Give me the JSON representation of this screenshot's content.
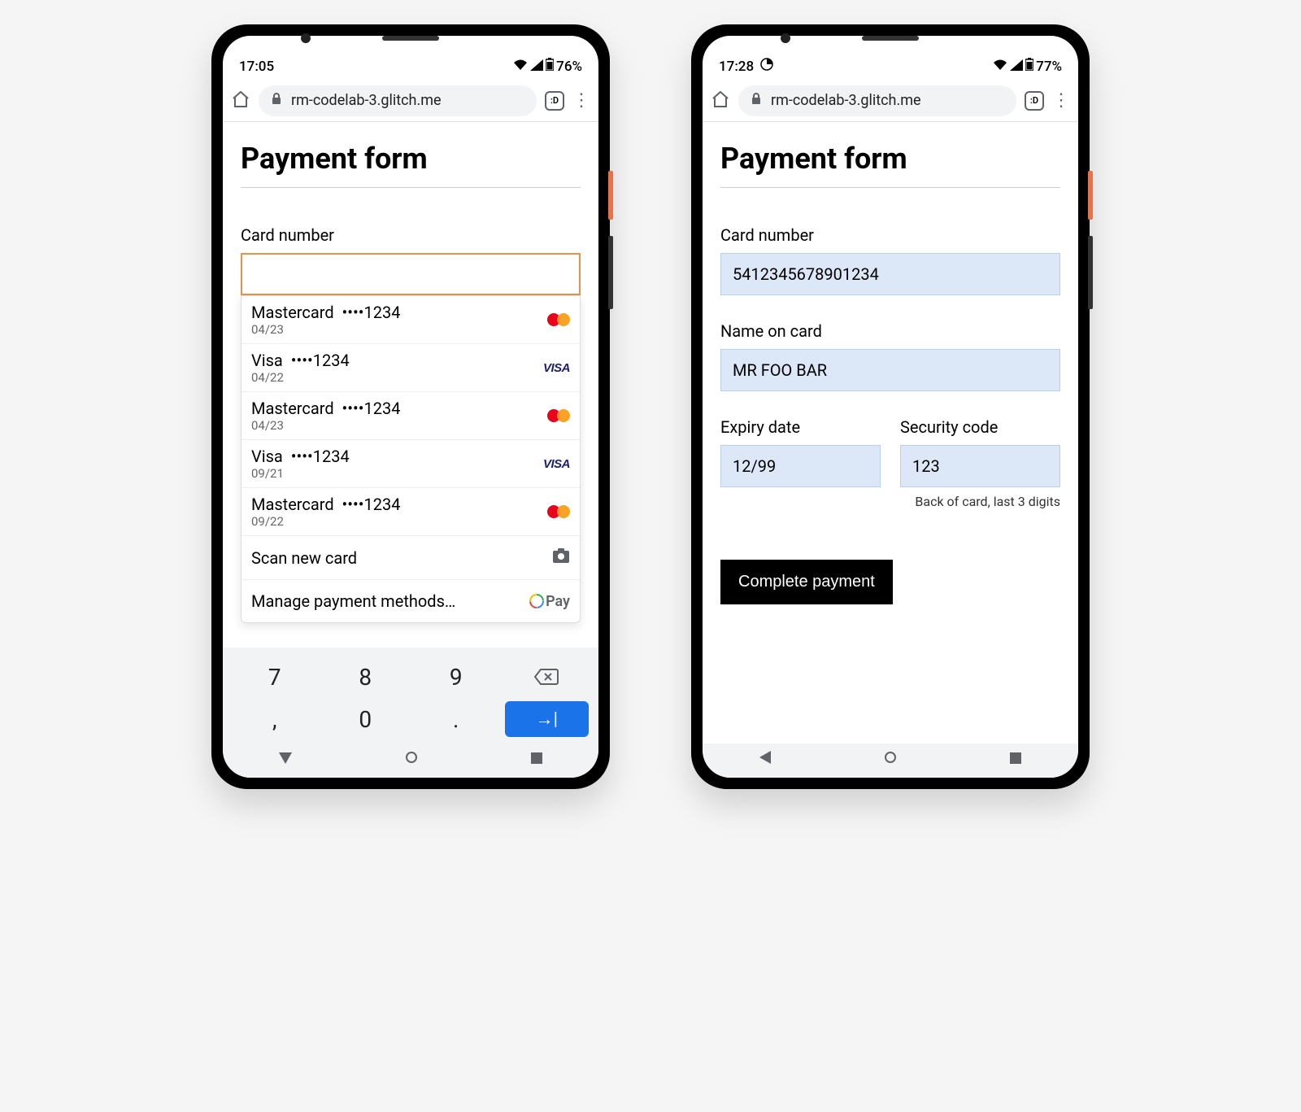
{
  "left": {
    "status": {
      "time": "17:05",
      "battery_text": "76%"
    },
    "url": "rm-codelab-3.glitch.me",
    "tab_count": ":D",
    "title": "Payment form",
    "card_number_label": "Card number",
    "autofill": [
      {
        "brand": "Mastercard",
        "mask": "••••1234",
        "exp": "04/23",
        "type": "mastercard"
      },
      {
        "brand": "Visa",
        "mask": "••••1234",
        "exp": "04/22",
        "type": "visa"
      },
      {
        "brand": "Mastercard",
        "mask": "••••1234",
        "exp": "04/23",
        "type": "mastercard"
      },
      {
        "brand": "Visa",
        "mask": "••••1234",
        "exp": "09/21",
        "type": "visa"
      },
      {
        "brand": "Mastercard",
        "mask": "••••1234",
        "exp": "09/22",
        "type": "mastercard"
      }
    ],
    "scan_label": "Scan new card",
    "manage_label": "Manage payment methods…",
    "keypad": {
      "r1": [
        "7",
        "8",
        "9"
      ],
      "r2": [
        ",",
        "0",
        "."
      ]
    }
  },
  "right": {
    "status": {
      "time": "17:28",
      "battery_text": "77%"
    },
    "url": "rm-codelab-3.glitch.me",
    "tab_count": ":D",
    "title": "Payment form",
    "card_number_label": "Card number",
    "card_number_value": "5412345678901234",
    "name_label": "Name on card",
    "name_value": "MR FOO BAR",
    "expiry_label": "Expiry date",
    "expiry_value": "12/99",
    "cvc_label": "Security code",
    "cvc_value": "123",
    "cvc_hint": "Back of card, last 3 digits",
    "submit_label": "Complete payment"
  }
}
